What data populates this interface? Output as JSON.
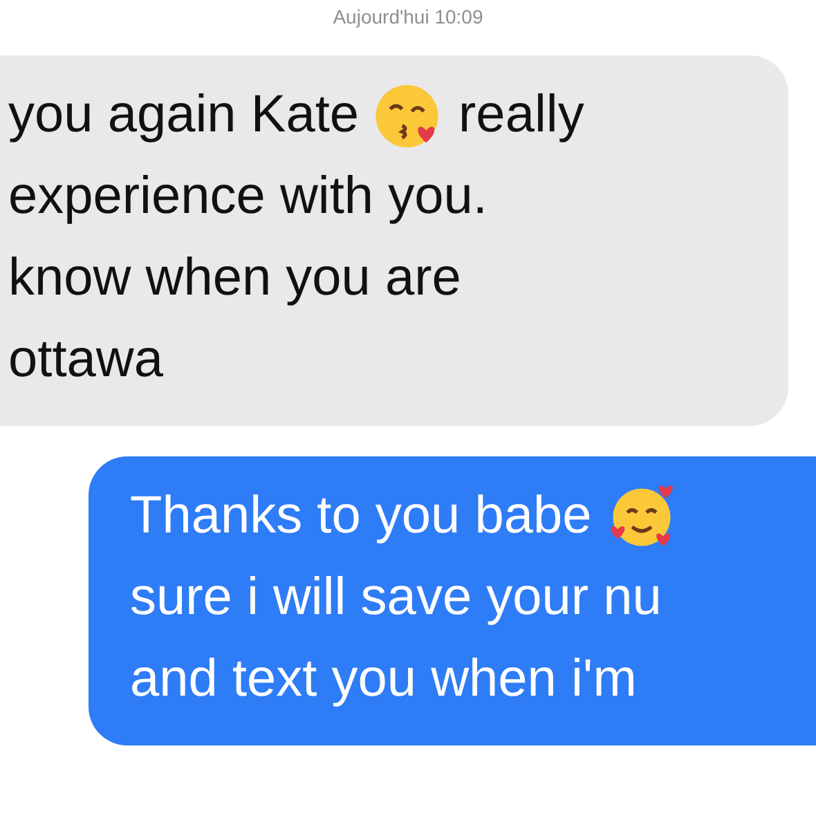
{
  "timestamp": "Aujourd'hui 10:09",
  "messages": [
    {
      "sent": false,
      "lines": [
        [
          {
            "kind": "text",
            "text": "you again Kate"
          },
          {
            "kind": "kiss"
          },
          {
            "kind": "text",
            "text": "really"
          }
        ],
        [
          {
            "kind": "text",
            "text": "experience with you."
          }
        ],
        [
          {
            "kind": "text",
            "text": "know when you are"
          }
        ],
        [
          {
            "kind": "text",
            "text": "ottawa"
          }
        ]
      ]
    },
    {
      "sent": true,
      "lines": [
        [
          {
            "kind": "text",
            "text": "Thanks to you babe"
          },
          {
            "kind": "hearts"
          }
        ],
        [
          {
            "kind": "text",
            "text": "sure i will save your nu"
          }
        ],
        [
          {
            "kind": "text",
            "text": "and text you when i'm"
          }
        ]
      ]
    }
  ]
}
